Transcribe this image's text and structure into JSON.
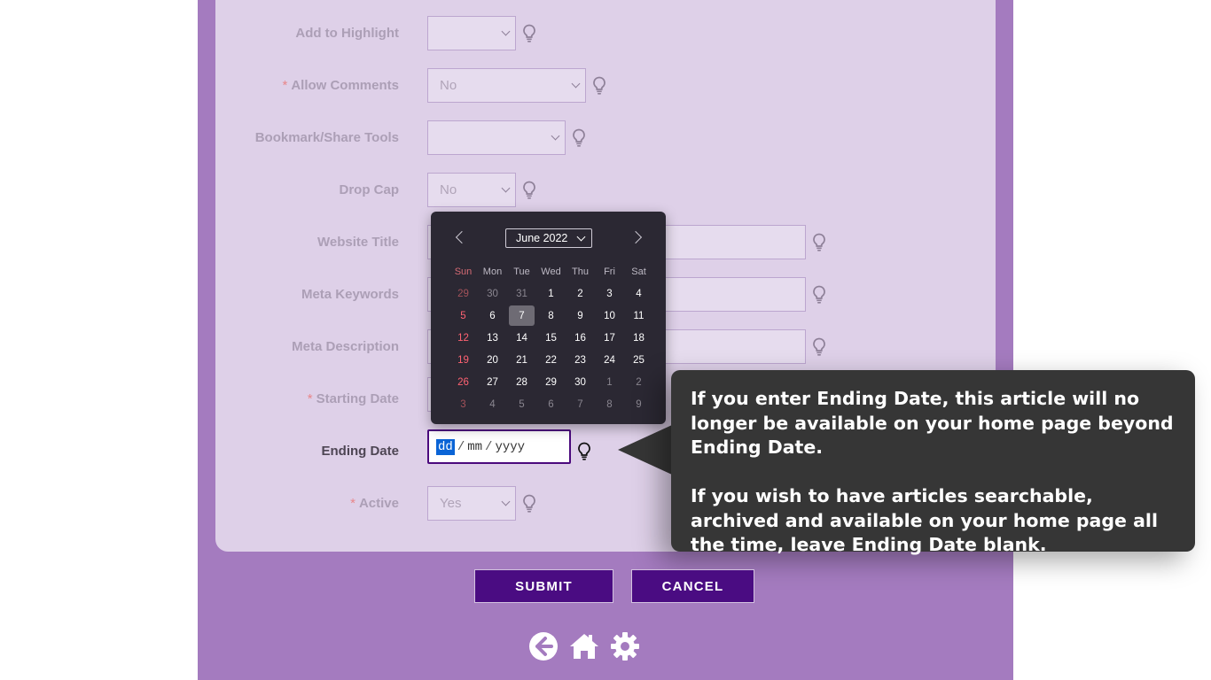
{
  "form": {
    "rows": [
      {
        "label": "Add to Highlight",
        "required": false,
        "value": ""
      },
      {
        "label": "Allow Comments",
        "required": true,
        "value": "No"
      },
      {
        "label": "Bookmark/Share Tools",
        "required": false,
        "value": ""
      },
      {
        "label": "Drop Cap",
        "required": false,
        "value": "No"
      },
      {
        "label": "Website Title",
        "required": false,
        "value": ""
      },
      {
        "label": "Meta Keywords",
        "required": false,
        "value": ""
      },
      {
        "label": "Meta Description",
        "required": false,
        "value": ""
      },
      {
        "label": "Starting Date",
        "required": true,
        "value": ""
      },
      {
        "label": "Ending Date",
        "required": false,
        "value": ""
      },
      {
        "label": "Active",
        "required": true,
        "value": "Yes"
      }
    ],
    "required_mark": "*"
  },
  "date_input": {
    "dd": "dd",
    "mm": "mm",
    "yyyy": "yyyy",
    "separator": "/"
  },
  "calendar": {
    "month_label": "June 2022",
    "weekdays": [
      "Sun",
      "Mon",
      "Tue",
      "Wed",
      "Thu",
      "Fri",
      "Sat"
    ],
    "weeks": [
      [
        {
          "d": "29",
          "o": true
        },
        {
          "d": "30",
          "o": true
        },
        {
          "d": "31",
          "o": true
        },
        {
          "d": "1"
        },
        {
          "d": "2"
        },
        {
          "d": "3"
        },
        {
          "d": "4"
        }
      ],
      [
        {
          "d": "5"
        },
        {
          "d": "6"
        },
        {
          "d": "7",
          "s": true
        },
        {
          "d": "8"
        },
        {
          "d": "9"
        },
        {
          "d": "10"
        },
        {
          "d": "11"
        }
      ],
      [
        {
          "d": "12"
        },
        {
          "d": "13"
        },
        {
          "d": "14"
        },
        {
          "d": "15"
        },
        {
          "d": "16"
        },
        {
          "d": "17"
        },
        {
          "d": "18"
        }
      ],
      [
        {
          "d": "19"
        },
        {
          "d": "20"
        },
        {
          "d": "21"
        },
        {
          "d": "22"
        },
        {
          "d": "23"
        },
        {
          "d": "24"
        },
        {
          "d": "25"
        }
      ],
      [
        {
          "d": "26"
        },
        {
          "d": "27"
        },
        {
          "d": "28"
        },
        {
          "d": "29"
        },
        {
          "d": "30"
        },
        {
          "d": "1",
          "o": true
        },
        {
          "d": "2",
          "o": true
        }
      ],
      [
        {
          "d": "3",
          "o": true
        },
        {
          "d": "4",
          "o": true
        },
        {
          "d": "5",
          "o": true
        },
        {
          "d": "6",
          "o": true
        },
        {
          "d": "7",
          "o": true
        },
        {
          "d": "8",
          "o": true
        },
        {
          "d": "9",
          "o": true
        }
      ]
    ]
  },
  "tooltip": {
    "paragraph1": "If you enter Ending Date, this article will no longer be available on your home page beyond Ending Date.",
    "paragraph2": "If you wish to have articles searchable, archived and available on your home page all the time, leave Ending Date blank."
  },
  "buttons": {
    "submit": "SUBMIT",
    "cancel": "CANCEL"
  },
  "footer": {
    "icons": [
      "back-arrow-icon",
      "home-icon",
      "gear-icon"
    ]
  },
  "colors": {
    "page_purple": "#a47bbf",
    "card_lilac": "#ded0e8",
    "button_purple": "#4a0c82",
    "tooltip_bg": "#363636",
    "calendar_bg": "#2b2833"
  }
}
